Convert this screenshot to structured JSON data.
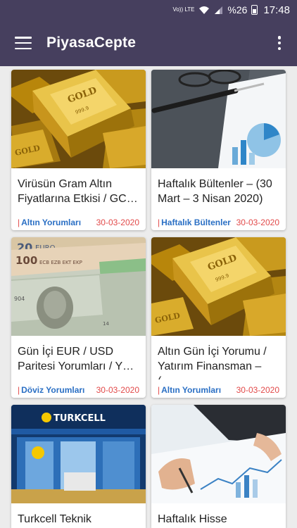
{
  "status_bar": {
    "network": "Vo)) LTE",
    "battery": "%26",
    "time": "17:48"
  },
  "app_bar": {
    "title": "PiyasaCepte",
    "menu_icon": "hamburger-menu-icon",
    "more_icon": "more-vert-icon"
  },
  "colors": {
    "app_bar": "#463f5e",
    "category": "#2a6fc4",
    "date": "#e24a4a",
    "background": "#ececec"
  },
  "articles": [
    {
      "title": "Virüsün Gram Altın Fiyatlarına Etkisi / GC…",
      "category": "Altın Yorumları",
      "date": "30-03-2020",
      "image": "gold-bars"
    },
    {
      "title": "Haftalık Bültenler – (30 Mart – 3 Nisan 2020)",
      "category": "Haftalık Bültenler",
      "date": "30-03-2020",
      "image": "glasses-pen-report"
    },
    {
      "title": "Gün İçi EUR / USD Paritesi Yorumları / Y…",
      "category": "Döviz Yorumları",
      "date": "30-03-2020",
      "image": "euro-dollar-banknotes"
    },
    {
      "title": "Altın Gün İçi Yorumu / Yatırım Finansman – (…",
      "category": "Altın Yorumları",
      "date": "30-03-2020",
      "image": "gold-bars"
    },
    {
      "title": "Turkcell Teknik",
      "category": "",
      "date": "",
      "image": "turkcell-store"
    },
    {
      "title": "Haftalık Hisse",
      "category": "",
      "date": "",
      "image": "hand-pen-chart"
    }
  ]
}
